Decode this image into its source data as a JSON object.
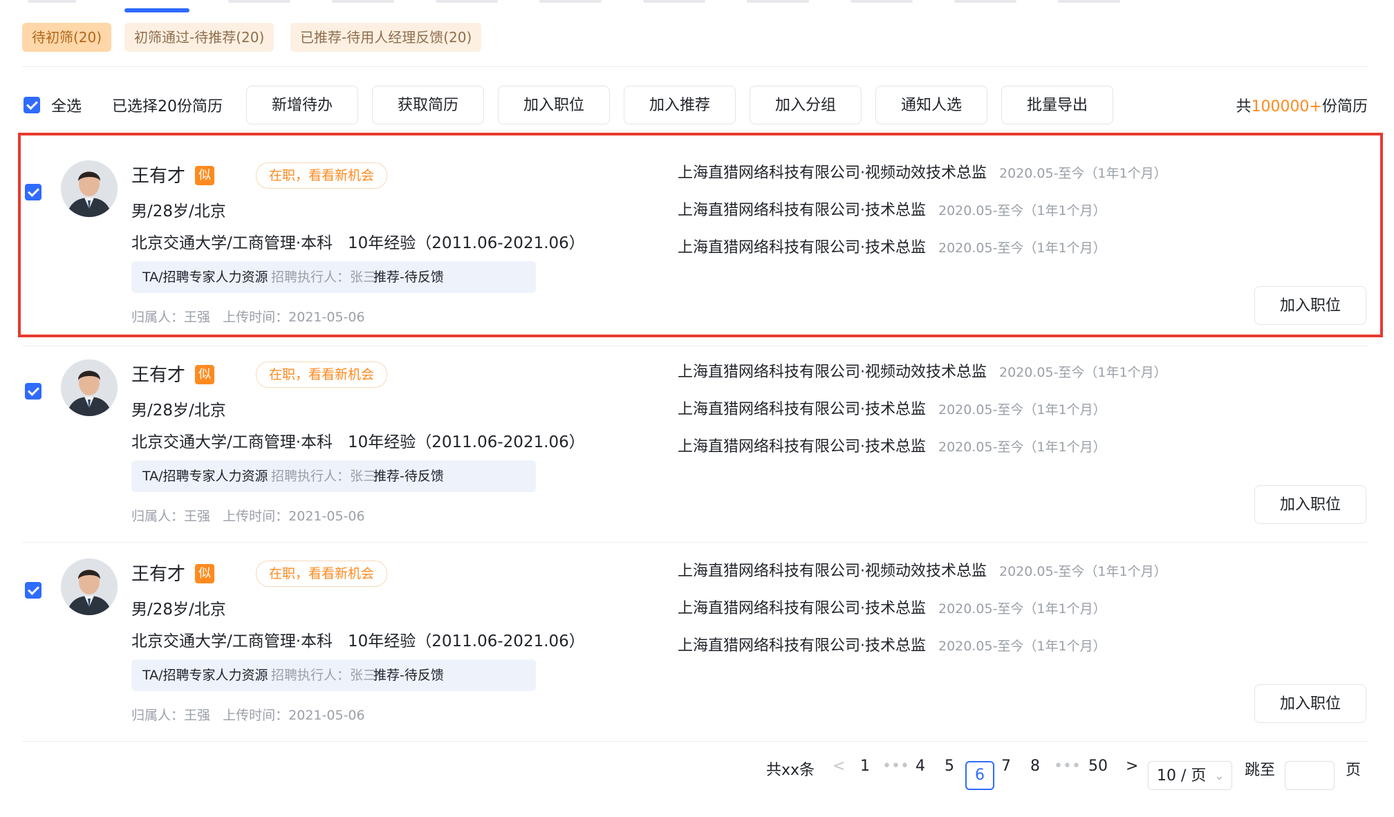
{
  "status_tabs": [
    {
      "label": "待初筛(20)",
      "active": true
    },
    {
      "label": "初筛通过-待推荐(20)",
      "active": false
    },
    {
      "label": "已推荐-待用人经理反馈(20)",
      "active": false
    }
  ],
  "toolbar": {
    "select_all": "全选",
    "selected_text": "已选择20份简历",
    "buttons": [
      "新增待办",
      "获取简历",
      "加入职位",
      "加入推荐",
      "加入分组",
      "通知人选",
      "批量导出"
    ],
    "total_prefix": "共",
    "total_count": "100000+",
    "total_suffix": "份简历"
  },
  "candidates": [
    {
      "name": "王有才",
      "tag": "似",
      "status": "在职，看看新机会",
      "basic": "男/28岁/北京",
      "education": "北京交通大学/工商管理·本科",
      "experience": "10年经验（2011.06-2021.06）",
      "role": "TA/招聘专家人力资源",
      "executor": "招聘执行人：张三",
      "progress": "推荐-待反馈",
      "owner": "归属人：王强",
      "upload": "上传时间：2021-05-06",
      "jobs": [
        {
          "title": "上海直猎网络科技有限公司·视频动效技术总监",
          "period": "2020.05-至今（1年1个月）"
        },
        {
          "title": "上海直猎网络科技有限公司·技术总监",
          "period": "2020.05-至今（1年1个月）"
        },
        {
          "title": "上海直猎网络科技有限公司·技术总监",
          "period": "2020.05-至今（1年1个月）"
        }
      ],
      "action": "加入职位"
    },
    {
      "name": "王有才",
      "tag": "似",
      "status": "在职，看看新机会",
      "basic": "男/28岁/北京",
      "education": "北京交通大学/工商管理·本科",
      "experience": "10年经验（2011.06-2021.06）",
      "role": "TA/招聘专家人力资源",
      "executor": "招聘执行人：张三",
      "progress": "推荐-待反馈",
      "owner": "归属人：王强",
      "upload": "上传时间：2021-05-06",
      "jobs": [
        {
          "title": "上海直猎网络科技有限公司·视频动效技术总监",
          "period": "2020.05-至今（1年1个月）"
        },
        {
          "title": "上海直猎网络科技有限公司·技术总监",
          "period": "2020.05-至今（1年1个月）"
        },
        {
          "title": "上海直猎网络科技有限公司·技术总监",
          "period": "2020.05-至今（1年1个月）"
        }
      ],
      "action": "加入职位"
    },
    {
      "name": "王有才",
      "tag": "似",
      "status": "在职，看看新机会",
      "basic": "男/28岁/北京",
      "education": "北京交通大学/工商管理·本科",
      "experience": "10年经验（2011.06-2021.06）",
      "role": "TA/招聘专家人力资源",
      "executor": "招聘执行人：张三",
      "progress": "推荐-待反馈",
      "owner": "归属人：王强",
      "upload": "上传时间：2021-05-06",
      "jobs": [
        {
          "title": "上海直猎网络科技有限公司·视频动效技术总监",
          "period": "2020.05-至今（1年1个月）"
        },
        {
          "title": "上海直猎网络科技有限公司·技术总监",
          "period": "2020.05-至今（1年1个月）"
        },
        {
          "title": "上海直猎网络科技有限公司·技术总监",
          "period": "2020.05-至今（1年1个月）"
        }
      ],
      "action": "加入职位"
    }
  ],
  "pagination": {
    "total": "共xx条",
    "prev": "<",
    "pages": [
      "1",
      "•••",
      "4",
      "5",
      "6",
      "7",
      "8",
      "•••",
      "50"
    ],
    "current": "6",
    "next": ">",
    "page_size": "10 / 页",
    "jump_label": "跳至",
    "page_unit": "页"
  },
  "colors": {
    "accent": "#2f6bff",
    "orange": "#ff8a1f",
    "highlight_border": "#e83a2e"
  }
}
